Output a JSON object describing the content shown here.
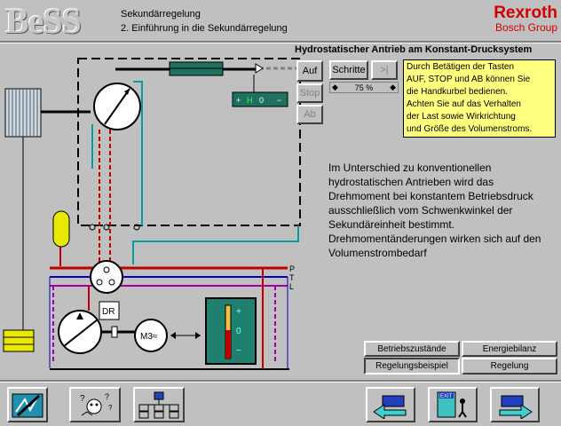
{
  "header": {
    "logo_text": "BeSS",
    "breadcrumb_line1": "Sekundärregelung",
    "breadcrumb_line2": "2. Einführung in die Sekundärregelung",
    "brand_name": "Rexroth",
    "brand_sub": "Bosch Group"
  },
  "diagram": {
    "title": "Hydrostatischer Antrieb am Konstant-Drucksystem",
    "line_labels": [
      "P",
      "T",
      "L"
    ],
    "dr_label": "DR",
    "motor_label": "M3≈",
    "gauge_scale": [
      "+",
      "0",
      "−"
    ],
    "indicator_scale": [
      "+",
      "H",
      "0",
      "−"
    ]
  },
  "controls": {
    "auf": "Auf",
    "stop": "Stop",
    "ab": "Ab",
    "schritte": "Schritte",
    "skip": ">|",
    "step_value": "75 %"
  },
  "info_box": [
    "Durch Betätigen der Tasten",
    "AUF, STOP und AB können Sie",
    "die Handkurbel bedienen.",
    "Achten Sie auf das Verhalten",
    "der Last sowie Wirkrichtung",
    "und Größe des Volumenstroms."
  ],
  "description": "Im Unterschied zu konventionellen hydrostatischen Antrieben wird das Drehmoment bei konstantem Betriebsdruck ausschließlich vom Schwenkwinkel der Sekundäreinheit bestimmt. Drehmomentänderungen wirken sich auf den Volumenstrombedarf",
  "tabs": {
    "betriebszustaende": "Betriebszustände",
    "energiebilanz": "Energiebilanz",
    "regelungsbeispiel": "Regelungsbeispiel",
    "regelung": "Regelung"
  },
  "footer": {
    "exit_label": "EXIT",
    "icons": [
      "notes-icon",
      "help-icon",
      "network-icon",
      "back-icon",
      "exit-icon",
      "forward-icon"
    ]
  },
  "colors": {
    "pressure_line": "#c00000",
    "tank_line": "#0000c0",
    "leak_line": "#a000a0",
    "control_line": "#00a0a0",
    "cylinder": "#207060",
    "gauge_bg": "#208070",
    "accumulator": "#e8e800"
  }
}
